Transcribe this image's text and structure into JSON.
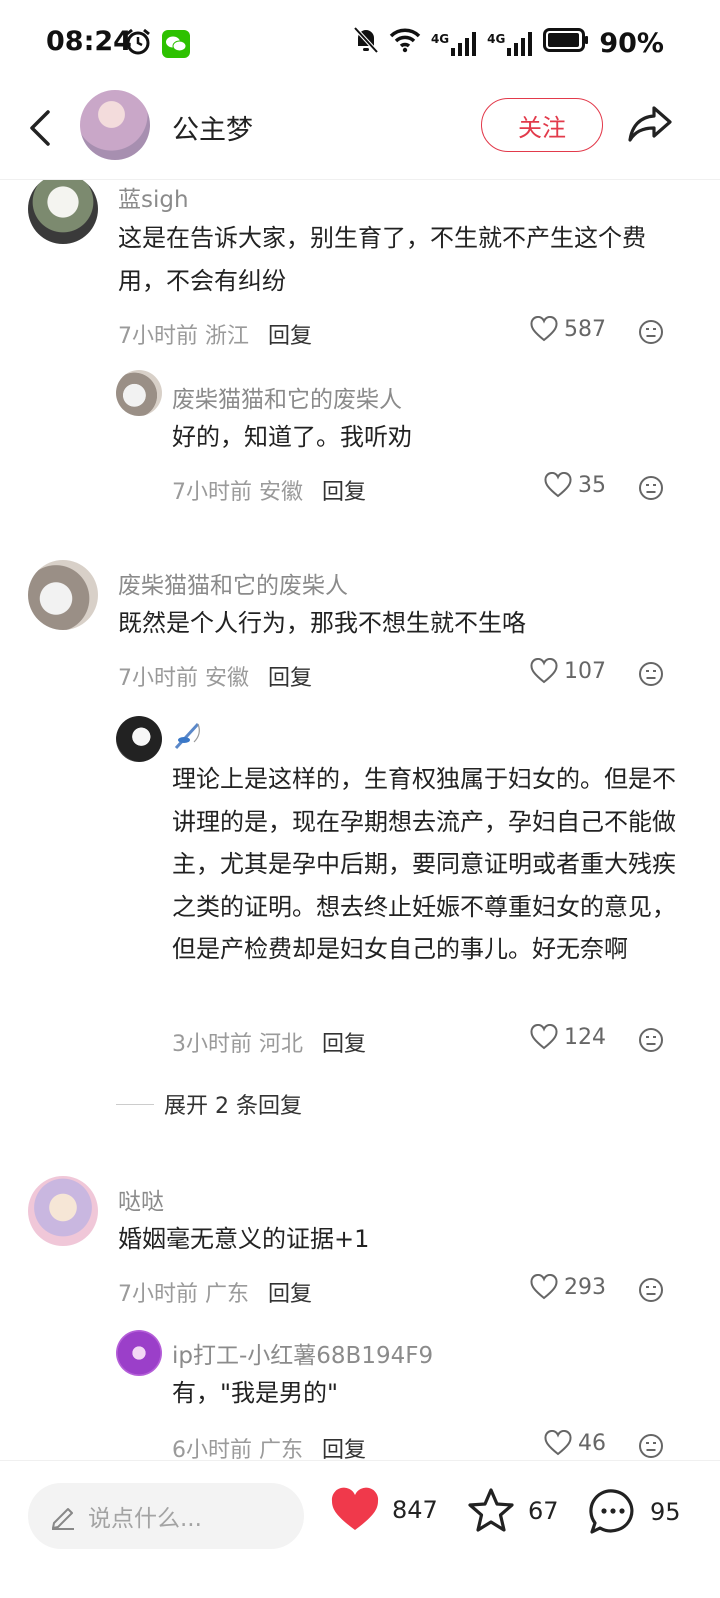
{
  "status_bar": {
    "time": "08:24",
    "battery": "90%",
    "network_1": "4G",
    "network_2": "4G",
    "icons": [
      "alarm-icon",
      "wechat-icon",
      "mute-bell-icon",
      "wifi-icon",
      "signal-icon",
      "battery-icon"
    ]
  },
  "header": {
    "title": "公主梦",
    "follow_label": "关注",
    "icons": [
      "back-arrow-icon",
      "share-icon"
    ]
  },
  "reply_label": "回复",
  "comments": [
    {
      "user": "蓝sigh",
      "text": "这是在告诉大家，别生育了，不生就不产生这个费用，不会有纠纷",
      "time": "7小时前",
      "location": "浙江",
      "likes": "587",
      "level": 0
    },
    {
      "user": "废柴猫猫和它的废柴人",
      "text": "好的，知道了。我听劝",
      "time": "7小时前",
      "location": "安徽",
      "likes": "35",
      "level": 1
    },
    {
      "user": "废柴猫猫和它的废柴人",
      "text": "既然是个人行为，那我不想生就不生咯",
      "time": "7小时前",
      "location": "安徽",
      "likes": "107",
      "level": 0
    },
    {
      "user": "",
      "text": "理论上是这样的，生育权独属于妇女的。但是不讲理的是，现在孕期想去流产，孕妇自己不能做主，尤其是孕中后期，要同意证明或者重大残疾之类的证明。想去终止妊娠不尊重妇女的意见，但是产检费却是妇女自己的事儿。好无奈啊",
      "time": "3小时前",
      "location": "河北",
      "likes": "124",
      "level": 1
    },
    {
      "user": "哒哒",
      "text": "婚姻毫无意义的证据+1",
      "time": "7小时前",
      "location": "广东",
      "likes": "293",
      "level": 0
    },
    {
      "user": "ip打工-小红薯68B194F9",
      "text": "有，\"我是男的\"",
      "time": "6小时前",
      "location": "广东",
      "likes": "46",
      "level": 1
    }
  ],
  "expand_replies": "展开 2 条回复",
  "bottom_bar": {
    "input_placeholder": "说点什么...",
    "likes": "847",
    "favorites": "67",
    "comments": "95",
    "colors": {
      "like_heart": "#f0394b",
      "follow_accent": "#e23a4b"
    }
  }
}
